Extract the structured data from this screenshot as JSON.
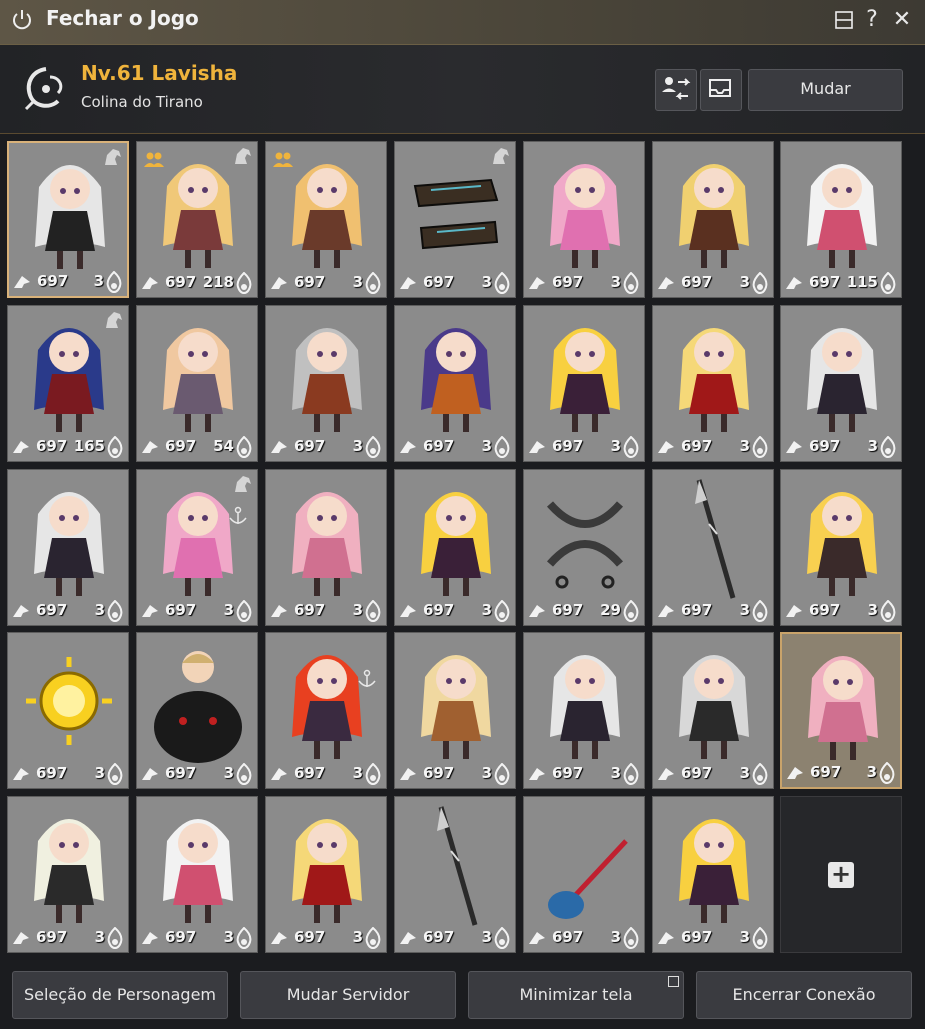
{
  "window": {
    "title": "Fechar o Jogo"
  },
  "character": {
    "level_name": "Nv.61  Lavisha",
    "location": "Colina do Tirano"
  },
  "actions": {
    "change_label": "Mudar"
  },
  "colors": {
    "accent_gold": "#f0b43c",
    "card_bg": "#8b8b8b",
    "selected_border": "#d9b27a"
  },
  "cards": [
    {
      "ilvl": "697",
      "level": "3",
      "art": "white-hair-gothic",
      "badge": "horse"
    },
    {
      "ilvl": "697",
      "level": "218",
      "art": "blonde-buns-mage",
      "badge": "horse",
      "party": true
    },
    {
      "ilvl": "697",
      "level": "3",
      "art": "blonde-hammer",
      "badge": "",
      "party": true
    },
    {
      "ilvl": "697",
      "level": "3",
      "art": "gauntlets",
      "badge": "horse"
    },
    {
      "ilvl": "697",
      "level": "3",
      "art": "pink-cat-hood",
      "badge": ""
    },
    {
      "ilvl": "697",
      "level": "3",
      "art": "cowgirl",
      "badge": ""
    },
    {
      "ilvl": "697",
      "level": "115",
      "art": "white-hair-fan",
      "badge": ""
    },
    {
      "ilvl": "697",
      "level": "165",
      "art": "blue-hair-fan",
      "badge": "horse"
    },
    {
      "ilvl": "697",
      "level": "54",
      "art": "blonde-glasses",
      "badge": ""
    },
    {
      "ilvl": "697",
      "level": "3",
      "art": "hooded-warrior",
      "badge": ""
    },
    {
      "ilvl": "697",
      "level": "3",
      "art": "purple-hair-ring",
      "badge": ""
    },
    {
      "ilvl": "697",
      "level": "3",
      "art": "bunny-blonde",
      "badge": ""
    },
    {
      "ilvl": "697",
      "level": "3",
      "art": "blonde-red-dress",
      "badge": ""
    },
    {
      "ilvl": "697",
      "level": "3",
      "art": "white-hood-dark",
      "badge": ""
    },
    {
      "ilvl": "697",
      "level": "3",
      "art": "white-hood-dark",
      "badge": ""
    },
    {
      "ilvl": "697",
      "level": "3",
      "art": "pink-cat-hood",
      "badge": "horse",
      "anchor": true
    },
    {
      "ilvl": "697",
      "level": "3",
      "art": "pink-hat",
      "badge": ""
    },
    {
      "ilvl": "697",
      "level": "3",
      "art": "bunny-blonde",
      "badge": ""
    },
    {
      "ilvl": "697",
      "level": "29",
      "art": "sickles",
      "badge": ""
    },
    {
      "ilvl": "697",
      "level": "3",
      "art": "spear",
      "badge": ""
    },
    {
      "ilvl": "697",
      "level": "3",
      "art": "blonde-scythe",
      "badge": ""
    },
    {
      "ilvl": "697",
      "level": "3",
      "art": "gold-orb",
      "badge": ""
    },
    {
      "ilvl": "697",
      "level": "3",
      "art": "black-beast",
      "badge": ""
    },
    {
      "ilvl": "697",
      "level": "3",
      "art": "red-hair",
      "badge": "",
      "anchor": true
    },
    {
      "ilvl": "697",
      "level": "3",
      "art": "blonde-lion",
      "badge": ""
    },
    {
      "ilvl": "697",
      "level": "3",
      "art": "white-hood-dark",
      "badge": ""
    },
    {
      "ilvl": "697",
      "level": "3",
      "art": "silver-ponytail",
      "badge": ""
    },
    {
      "ilvl": "697",
      "level": "3",
      "art": "pink-hat",
      "badge": "",
      "highlight": true
    },
    {
      "ilvl": "697",
      "level": "3",
      "art": "witch",
      "badge": ""
    },
    {
      "ilvl": "697",
      "level": "3",
      "art": "white-hair-fan",
      "badge": ""
    },
    {
      "ilvl": "697",
      "level": "3",
      "art": "blonde-red-dress",
      "badge": ""
    },
    {
      "ilvl": "697",
      "level": "3",
      "art": "spear",
      "badge": ""
    },
    {
      "ilvl": "697",
      "level": "3",
      "art": "crystal-staff",
      "badge": ""
    },
    {
      "ilvl": "697",
      "level": "3",
      "art": "bunny-blonde",
      "badge": ""
    }
  ],
  "footer": {
    "select_character": "Seleção de Personagem",
    "change_server": "Mudar Servidor",
    "minimize": "Minimizar tela",
    "disconnect": "Encerrar Conexão"
  }
}
